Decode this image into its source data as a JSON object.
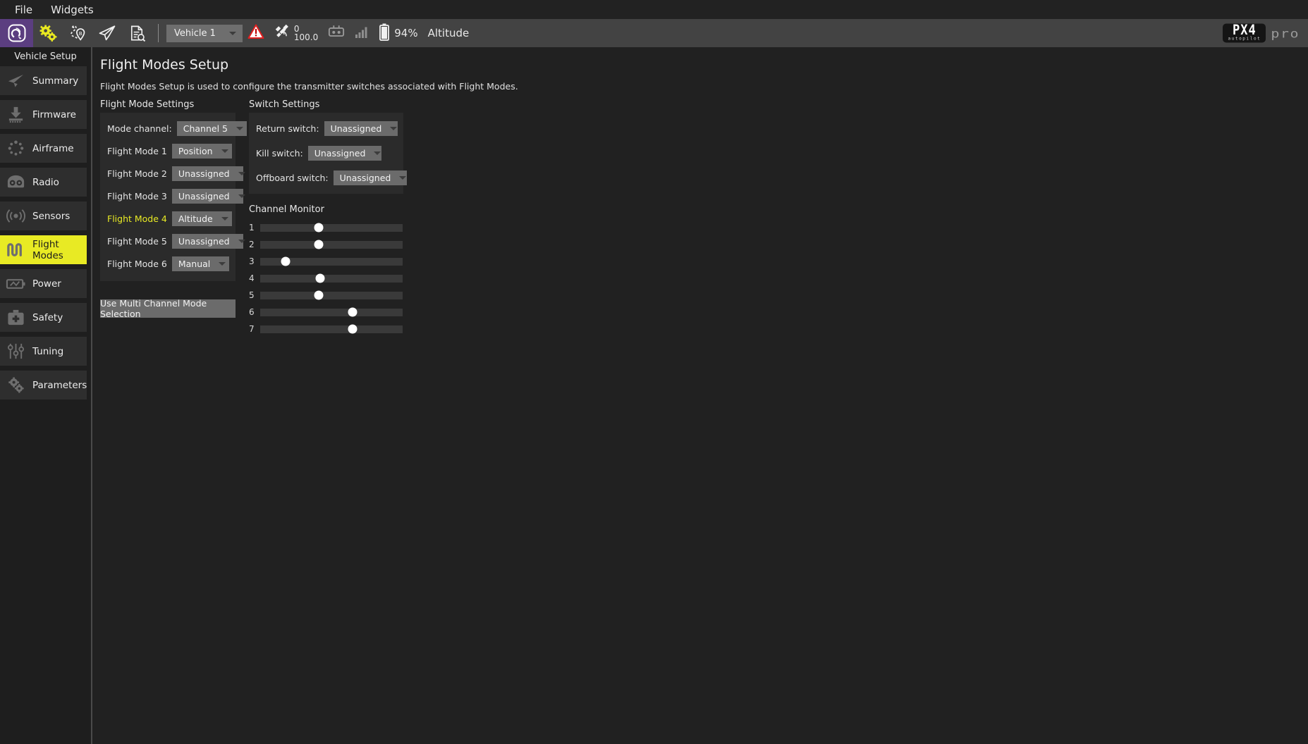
{
  "menubar": {
    "items": [
      {
        "label": "File",
        "name": "menu-file"
      },
      {
        "label": "Widgets",
        "name": "menu-widgets"
      }
    ]
  },
  "toolbar": {
    "icons": [
      {
        "name": "qgc-home-icon",
        "title": "QGroundControl"
      },
      {
        "name": "gears-setup-icon",
        "title": "Vehicle Setup"
      },
      {
        "name": "plan-route-icon",
        "title": "Plan"
      },
      {
        "name": "fly-paperplane-icon",
        "title": "Fly"
      },
      {
        "name": "analyze-document-icon",
        "title": "Analyze"
      }
    ],
    "vehicle_selector": "Vehicle 1",
    "warning_icon": "warning-triangle-icon",
    "gps_icon": "gps-satellite-icon",
    "gps_count": "0",
    "gps_hdop": "100.0",
    "rc_icon": "rc-controller-icon",
    "signal_icon": "signal-bars-icon",
    "battery_icon": "battery-icon",
    "battery_percent": "94%",
    "flight_mode": "Altitude",
    "logo_main": "PX4",
    "logo_sub": "autopilot",
    "logo_pro": "pro",
    "accent_purple": "#5b3e80"
  },
  "sidebar": {
    "title": "Vehicle Setup",
    "active_color": "#e8ea24",
    "items": [
      {
        "label": "Summary",
        "icon": "paperplane-icon",
        "active": false
      },
      {
        "label": "Firmware",
        "icon": "download-chip-icon",
        "active": false
      },
      {
        "label": "Airframe",
        "icon": "airframe-dots-icon",
        "active": false
      },
      {
        "label": "Radio",
        "icon": "radio-icon",
        "active": false
      },
      {
        "label": "Sensors",
        "icon": "sensors-waves-icon",
        "active": false
      },
      {
        "label": "Flight Modes",
        "icon": "flight-modes-icon",
        "active": true
      },
      {
        "label": "Power",
        "icon": "battery-power-icon",
        "active": false
      },
      {
        "label": "Safety",
        "icon": "safety-kit-icon",
        "active": false
      },
      {
        "label": "Tuning",
        "icon": "tuning-sliders-icon",
        "active": false
      },
      {
        "label": "Parameters",
        "icon": "parameters-gears-icon",
        "active": false
      }
    ]
  },
  "main": {
    "page_title": "Flight Modes Setup",
    "page_description": "Flight Modes Setup is used to configure the transmitter switches associated with Flight Modes.",
    "flight_mode_settings": {
      "group_title": "Flight Mode Settings",
      "mode_channel_label": "Mode channel:",
      "mode_channel_value": "Channel 5",
      "modes": [
        {
          "label": "Flight Mode 1",
          "value": "Position",
          "highlighted": false
        },
        {
          "label": "Flight Mode 2",
          "value": "Unassigned",
          "highlighted": false
        },
        {
          "label": "Flight Mode 3",
          "value": "Unassigned",
          "highlighted": false
        },
        {
          "label": "Flight Mode 4",
          "value": "Altitude",
          "highlighted": true
        },
        {
          "label": "Flight Mode 5",
          "value": "Unassigned",
          "highlighted": false
        },
        {
          "label": "Flight Mode 6",
          "value": "Manual",
          "highlighted": false
        }
      ],
      "multi_channel_button": "Use Multi Channel Mode Selection"
    },
    "switch_settings": {
      "group_title": "Switch Settings",
      "switches": [
        {
          "label": "Return switch:",
          "value": "Unassigned"
        },
        {
          "label": "Kill switch:",
          "value": "Unassigned"
        },
        {
          "label": "Offboard switch:",
          "value": "Unassigned"
        }
      ]
    },
    "channel_monitor": {
      "title": "Channel Monitor",
      "channels": [
        {
          "number": "1",
          "position_pct": 41
        },
        {
          "number": "2",
          "position_pct": 41
        },
        {
          "number": "3",
          "position_pct": 18
        },
        {
          "number": "4",
          "position_pct": 42
        },
        {
          "number": "5",
          "position_pct": 41
        },
        {
          "number": "6",
          "position_pct": 65
        },
        {
          "number": "7",
          "position_pct": 65
        }
      ]
    }
  }
}
